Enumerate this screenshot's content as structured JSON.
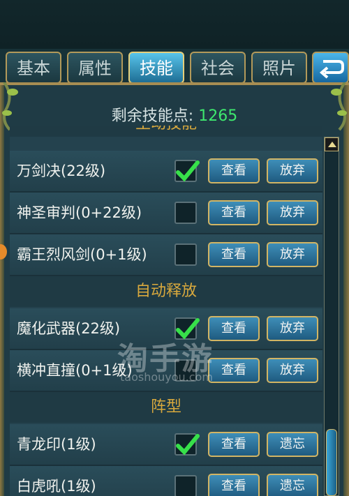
{
  "tabs": [
    {
      "label": "基本",
      "active": false
    },
    {
      "label": "属性",
      "active": false
    },
    {
      "label": "技能",
      "active": true
    },
    {
      "label": "社会",
      "active": false
    },
    {
      "label": "照片",
      "active": false
    }
  ],
  "back_icon": "return-arrow-icon",
  "remaining": {
    "label": "剩余技能点:",
    "value": "1265"
  },
  "partial_section_label": "主动技能",
  "sections": [
    {
      "key": "active",
      "skills": [
        {
          "name": "万剑决(22级)",
          "checked": true,
          "view": "查看",
          "action": "放弃"
        },
        {
          "name": "神圣审判(0+22级)",
          "checked": false,
          "view": "查看",
          "action": "放弃"
        },
        {
          "name": "霸王烈风剑(0+1级)",
          "checked": false,
          "view": "查看",
          "action": "放弃"
        }
      ]
    },
    {
      "key": "auto",
      "title": "自动释放",
      "skills": [
        {
          "name": "魔化武器(22级)",
          "checked": true,
          "view": "查看",
          "action": "放弃"
        },
        {
          "name": "横冲直撞(0+1级)",
          "checked": false,
          "view": "查看",
          "action": "放弃"
        }
      ]
    },
    {
      "key": "formation",
      "title": "阵型",
      "skills": [
        {
          "name": "青龙印(1级)",
          "checked": true,
          "view": "查看",
          "action": "遗忘"
        },
        {
          "name": "白虎吼(1级)",
          "checked": false,
          "view": "查看",
          "action": "遗忘"
        }
      ]
    }
  ],
  "watermark": {
    "main": "淘手游",
    "sub": "taoshouyou.com"
  },
  "colors": {
    "accent_green": "#3ee86e",
    "section_gold": "#d9a93d",
    "button_border": "#d2b564"
  }
}
